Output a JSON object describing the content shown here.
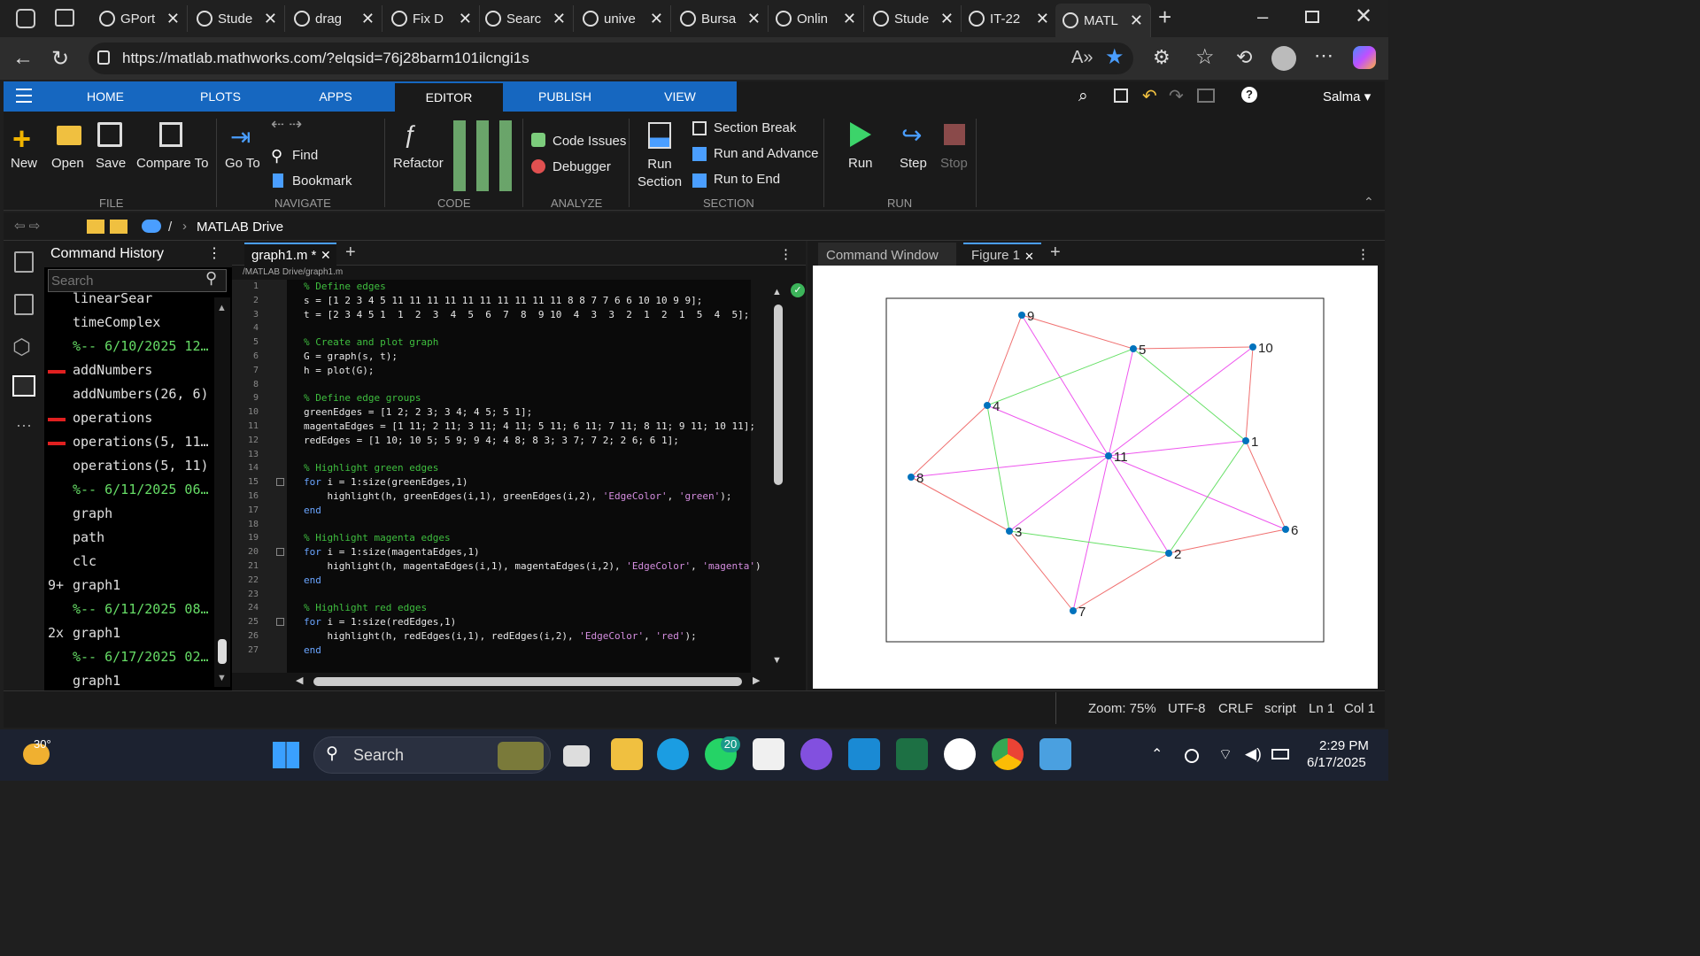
{
  "browser": {
    "tabs": [
      {
        "label": "GPort"
      },
      {
        "label": "Stude"
      },
      {
        "label": "drag"
      },
      {
        "label": "Fix D"
      },
      {
        "label": "Searc"
      },
      {
        "label": "unive"
      },
      {
        "label": "Bursa"
      },
      {
        "label": "Onlin"
      },
      {
        "label": "Stude"
      },
      {
        "label": "IT-22"
      },
      {
        "label": "MATL"
      }
    ],
    "url": "https://matlab.mathworks.com/?elqsid=76j28barm101ilcngi1s"
  },
  "matlab": {
    "tabs": [
      "HOME",
      "PLOTS",
      "APPS",
      "EDITOR",
      "PUBLISH",
      "VIEW"
    ],
    "user": "Salma",
    "toolstrip": {
      "file": {
        "group": "FILE",
        "new": "New",
        "open": "Open",
        "save": "Save",
        "compare": "Compare To"
      },
      "navigate": {
        "group": "NAVIGATE",
        "goto": "Go To",
        "find": "Find",
        "bookmark": "Bookmark"
      },
      "code": {
        "group": "CODE",
        "refactor": "Refactor"
      },
      "analyze": {
        "group": "ANALYZE",
        "code_issues": "Code Issues",
        "debugger": "Debugger"
      },
      "section": {
        "group": "SECTION",
        "run_section_1": "Run",
        "run_section_2": "Section",
        "section_break": "Section Break",
        "run_advance": "Run and Advance",
        "run_end": "Run to End"
      },
      "run": {
        "group": "RUN",
        "run": "Run",
        "step": "Step",
        "stop": "Stop"
      }
    },
    "path": {
      "sep": "/",
      "current": "MATLAB Drive"
    },
    "history": {
      "title": "Command History",
      "search_placeholder": "Search",
      "items": [
        {
          "prefix": "",
          "text": "linearSear",
          "marker": false,
          "session": false
        },
        {
          "prefix": "",
          "text": "timeComplex",
          "marker": false,
          "session": false
        },
        {
          "prefix": "",
          "text": "%-- 6/10/2025 12…",
          "marker": false,
          "session": true
        },
        {
          "prefix": "",
          "text": "addNumbers",
          "marker": true,
          "session": false
        },
        {
          "prefix": "",
          "text": "addNumbers(26, 6)",
          "marker": false,
          "session": false
        },
        {
          "prefix": "",
          "text": "operations",
          "marker": true,
          "session": false
        },
        {
          "prefix": "",
          "text": "operations(5, 11…",
          "marker": true,
          "session": false
        },
        {
          "prefix": "",
          "text": "operations(5, 11)",
          "marker": false,
          "session": false
        },
        {
          "prefix": "",
          "text": "%-- 6/11/2025 06…",
          "marker": false,
          "session": true
        },
        {
          "prefix": "",
          "text": "graph",
          "marker": false,
          "session": false
        },
        {
          "prefix": "",
          "text": "path",
          "marker": false,
          "session": false
        },
        {
          "prefix": "",
          "text": "clc",
          "marker": false,
          "session": false
        },
        {
          "prefix": "9+",
          "text": "graph1",
          "marker": false,
          "session": false
        },
        {
          "prefix": "",
          "text": "%-- 6/11/2025 08…",
          "marker": false,
          "session": true
        },
        {
          "prefix": "2x",
          "text": "graph1",
          "marker": false,
          "session": false
        },
        {
          "prefix": "",
          "text": "%-- 6/17/2025 02…",
          "marker": false,
          "session": true
        },
        {
          "prefix": "",
          "text": "graph1",
          "marker": false,
          "session": false
        }
      ]
    },
    "editor": {
      "tab": "graph1.m *",
      "filepath": "/MATLAB Drive/graph1.m",
      "lines": [
        [
          [
            "cm",
            "% Define edges"
          ]
        ],
        [
          [
            "",
            "s = [1 2 3 4 5 11 11 11 11 11 11 11 11 11 11 8 8 7 7 6 6 10 10 9 9];"
          ]
        ],
        [
          [
            "",
            "t = [2 3 4 5 1  1  2  3  4  5  6  7  8  9 10  4  3  3  2  1  2  1  5  4  5];"
          ]
        ],
        [
          [
            "",
            ""
          ]
        ],
        [
          [
            "cm",
            "% Create and plot graph"
          ]
        ],
        [
          [
            "",
            "G = graph(s, t);"
          ]
        ],
        [
          [
            "",
            "h = plot(G);"
          ]
        ],
        [
          [
            "",
            ""
          ]
        ],
        [
          [
            "cm",
            "% Define edge groups"
          ]
        ],
        [
          [
            "",
            "greenEdges = [1 2; 2 3; 3 4; 4 5; 5 1];"
          ]
        ],
        [
          [
            "",
            "magentaEdges = [1 11; 2 11; 3 11; 4 11; 5 11; 6 11; 7 11; 8 11; 9 11; 10 11];"
          ]
        ],
        [
          [
            "",
            "redEdges = [1 10; 10 5; 5 9; 9 4; 4 8; 8 3; 3 7; 7 2; 2 6; 6 1];"
          ]
        ],
        [
          [
            "",
            ""
          ]
        ],
        [
          [
            "cm",
            "% Highlight green edges"
          ]
        ],
        [
          [
            "kw",
            "for"
          ],
          [
            "",
            " i = 1:size(greenEdges,1)"
          ]
        ],
        [
          [
            "",
            "    highlight(h, greenEdges(i,1), greenEdges(i,2), "
          ],
          [
            "st",
            "'EdgeColor'"
          ],
          [
            "",
            ", "
          ],
          [
            "st",
            "'green'"
          ],
          [
            "",
            ");"
          ]
        ],
        [
          [
            "kw",
            "end"
          ]
        ],
        [
          [
            "",
            ""
          ]
        ],
        [
          [
            "cm",
            "% Highlight magenta edges"
          ]
        ],
        [
          [
            "kw",
            "for"
          ],
          [
            "",
            " i = 1:size(magentaEdges,1)"
          ]
        ],
        [
          [
            "",
            "    highlight(h, magentaEdges(i,1), magentaEdges(i,2), "
          ],
          [
            "st",
            "'EdgeColor'"
          ],
          [
            "",
            ", "
          ],
          [
            "st",
            "'magenta'"
          ],
          [
            "",
            ")"
          ]
        ],
        [
          [
            "kw",
            "end"
          ]
        ],
        [
          [
            "",
            ""
          ]
        ],
        [
          [
            "cm",
            "% Highlight red edges"
          ]
        ],
        [
          [
            "kw",
            "for"
          ],
          [
            "",
            " i = 1:size(redEdges,1)"
          ]
        ],
        [
          [
            "",
            "    highlight(h, redEdges(i,1), redEdges(i,2), "
          ],
          [
            "st",
            "'EdgeColor'"
          ],
          [
            "",
            ", "
          ],
          [
            "st",
            "'red'"
          ],
          [
            "",
            ");"
          ]
        ],
        [
          [
            "kw",
            "end"
          ]
        ]
      ]
    },
    "right_tabs": {
      "command_window": "Command Window",
      "figure": "Figure 1"
    },
    "figure": {
      "node_labels": [
        "1",
        "2",
        "3",
        "4",
        "5",
        "6",
        "7",
        "8",
        "9",
        "10",
        "11"
      ],
      "green_edges": [
        [
          1,
          2
        ],
        [
          2,
          3
        ],
        [
          3,
          4
        ],
        [
          4,
          5
        ],
        [
          5,
          1
        ]
      ],
      "magenta_edges": [
        [
          1,
          11
        ],
        [
          2,
          11
        ],
        [
          3,
          11
        ],
        [
          4,
          11
        ],
        [
          5,
          11
        ],
        [
          6,
          11
        ],
        [
          7,
          11
        ],
        [
          8,
          11
        ],
        [
          9,
          11
        ],
        [
          10,
          11
        ]
      ],
      "red_edges": [
        [
          1,
          10
        ],
        [
          10,
          5
        ],
        [
          5,
          9
        ],
        [
          9,
          4
        ],
        [
          4,
          8
        ],
        [
          8,
          3
        ],
        [
          3,
          7
        ],
        [
          7,
          2
        ],
        [
          2,
          6
        ],
        [
          6,
          1
        ]
      ],
      "colors": {
        "green": "#66e066",
        "magenta": "#ee55ee",
        "red": "#f07070",
        "node": "#0072bd"
      }
    },
    "status": {
      "zoom": "Zoom: 75%",
      "encoding": "UTF-8",
      "eol": "CRLF",
      "type": "script",
      "ln": "Ln 1",
      "col": "Col 1"
    }
  },
  "taskbar": {
    "weather": "30°",
    "search": "Search",
    "whatsapp_badge": "20",
    "time": "2:29 PM",
    "date": "6/17/2025"
  }
}
